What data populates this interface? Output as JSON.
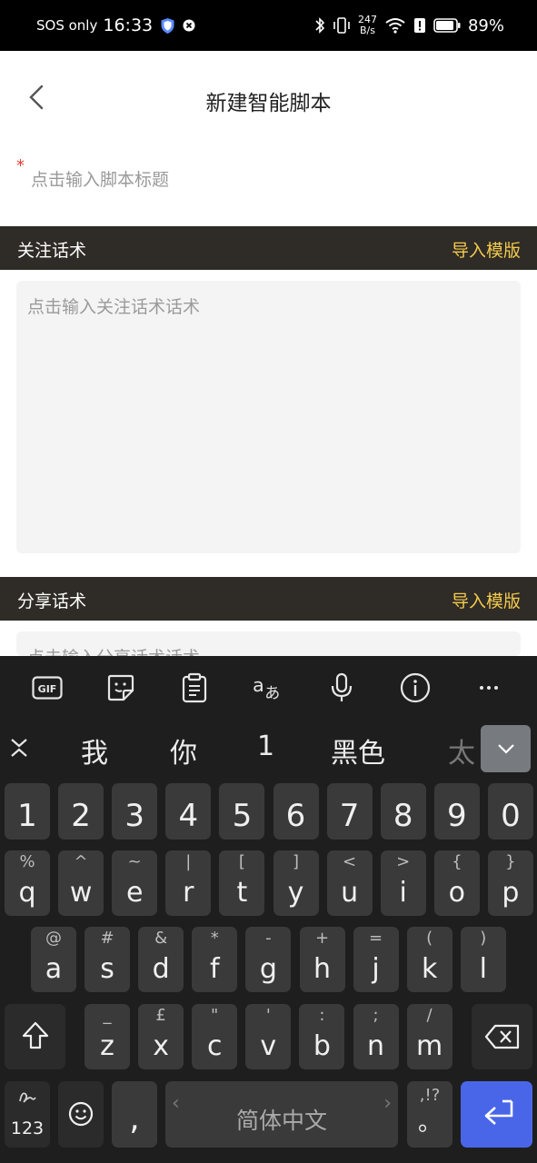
{
  "status_bar": {
    "carrier": "SOS only",
    "time": "16:33",
    "net_speed_value": "247",
    "net_speed_unit": "B/s",
    "battery": "89%"
  },
  "header": {
    "title": "新建智能脚本"
  },
  "title_field": {
    "required_mark": "*",
    "placeholder": "点击输入脚本标题"
  },
  "sections": [
    {
      "label": "关注话术",
      "import": "导入模版",
      "placeholder": "点击输入关注话术话术"
    },
    {
      "label": "分享话术",
      "import": "导入模版",
      "placeholder": "点击输入分享话术话术"
    }
  ],
  "keyboard": {
    "toolbar": [
      "gif-icon",
      "sticker-icon",
      "clipboard-icon",
      "translate-icon",
      "microphone-icon",
      "info-icon",
      "more-icon"
    ],
    "candidates": [
      "我",
      "你",
      "1",
      "黑色",
      "太"
    ],
    "number_row": [
      "1",
      "2",
      "3",
      "4",
      "5",
      "6",
      "7",
      "8",
      "9",
      "0"
    ],
    "row1": [
      {
        "main": "q",
        "sub": "%"
      },
      {
        "main": "w",
        "sub": "^"
      },
      {
        "main": "e",
        "sub": "~"
      },
      {
        "main": "r",
        "sub": "|"
      },
      {
        "main": "t",
        "sub": "["
      },
      {
        "main": "y",
        "sub": "]"
      },
      {
        "main": "u",
        "sub": "<"
      },
      {
        "main": "i",
        "sub": ">"
      },
      {
        "main": "o",
        "sub": "{"
      },
      {
        "main": "p",
        "sub": "}"
      }
    ],
    "row2": [
      {
        "main": "a",
        "sub": "@"
      },
      {
        "main": "s",
        "sub": "#"
      },
      {
        "main": "d",
        "sub": "&"
      },
      {
        "main": "f",
        "sub": "*"
      },
      {
        "main": "g",
        "sub": "-"
      },
      {
        "main": "h",
        "sub": "+"
      },
      {
        "main": "j",
        "sub": "="
      },
      {
        "main": "k",
        "sub": "("
      },
      {
        "main": "l",
        "sub": ")"
      }
    ],
    "row3": [
      {
        "main": "z",
        "sub": "_"
      },
      {
        "main": "x",
        "sub": "£"
      },
      {
        "main": "c",
        "sub": "\""
      },
      {
        "main": "v",
        "sub": "'"
      },
      {
        "main": "b",
        "sub": ":"
      },
      {
        "main": "n",
        "sub": ";"
      },
      {
        "main": "m",
        "sub": "/"
      }
    ],
    "numeric_label": "123",
    "comma": ",",
    "space_label": "简体中文",
    "period_sub": ",!?",
    "period": "。",
    "colors": {
      "enter": "#4a66e8",
      "import_link": "#f3cb4d",
      "section_bar": "#2f2b26"
    }
  }
}
